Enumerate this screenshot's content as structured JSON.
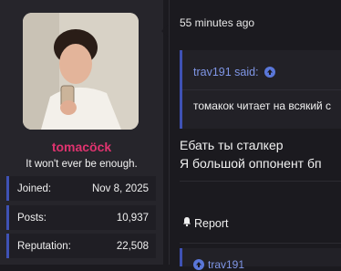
{
  "user": {
    "name": "tomacöck",
    "title": "It won't ever be enough.",
    "stats": [
      {
        "label": "Joined:",
        "value": "Nov 8, 2025"
      },
      {
        "label": "Posts:",
        "value": "10,937"
      },
      {
        "label": "Reputation:",
        "value": "22,508"
      }
    ]
  },
  "post": {
    "timestamp": "55 minutes ago",
    "quote": {
      "author": "trav191 said:",
      "text": "томакок читает на всякий с"
    },
    "message": [
      "Ебать ты сталкер",
      "Я большой оппонент бп"
    ],
    "report_label": "Report",
    "next_quote_author": "trav191"
  },
  "colors": {
    "username": "#e0336f",
    "accent": "#3f52b5",
    "link": "#7f96e6"
  },
  "icons": {
    "quote_link": "arrow-up-circle-icon",
    "report": "bell-icon"
  }
}
